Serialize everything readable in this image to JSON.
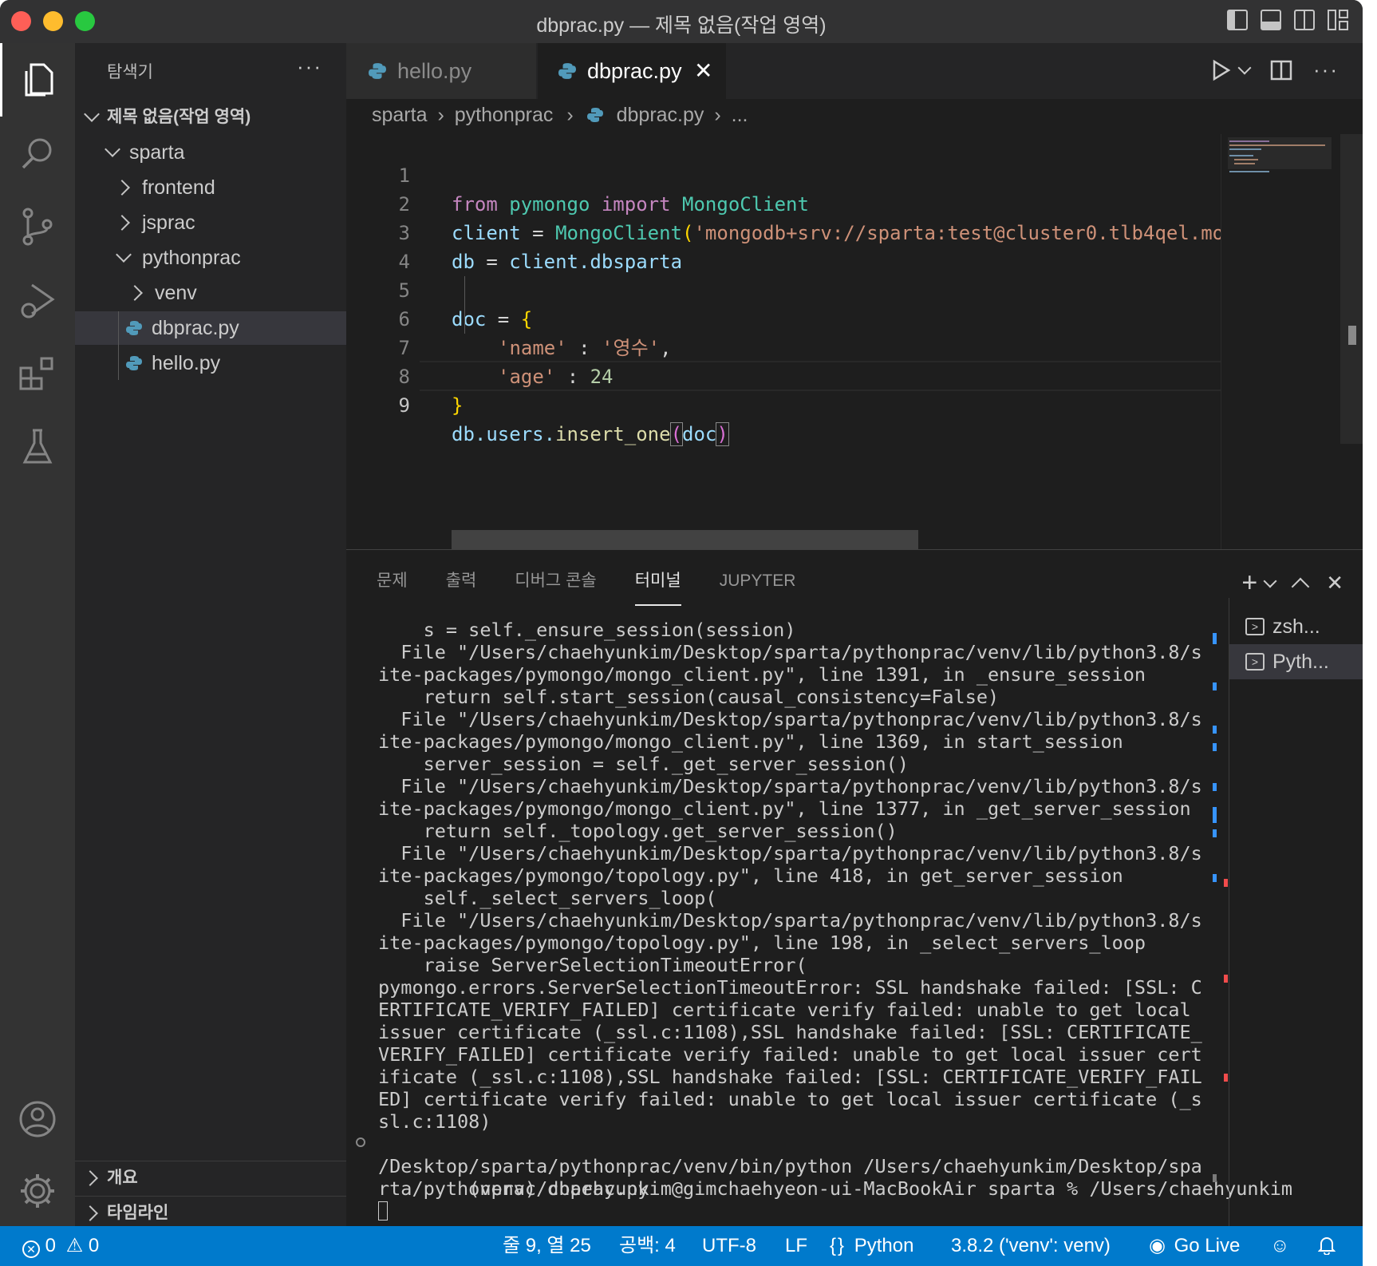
{
  "window": {
    "title": "dbprac.py — 제목 없음(작업 영역)"
  },
  "explorer": {
    "title": "탐색기",
    "workspace": "제목 없음(작업 영역)",
    "items": [
      {
        "label": "sparta"
      },
      {
        "label": "frontend"
      },
      {
        "label": "jsprac"
      },
      {
        "label": "pythonprac"
      },
      {
        "label": "venv"
      },
      {
        "label": "dbprac.py"
      },
      {
        "label": "hello.py"
      }
    ],
    "sections": [
      {
        "label": "개요"
      },
      {
        "label": "타임라인"
      }
    ]
  },
  "tabs": [
    {
      "label": "hello.py"
    },
    {
      "label": "dbprac.py"
    }
  ],
  "breadcrumb": [
    "sparta",
    "pythonprac",
    "dbprac.py",
    "..."
  ],
  "code": {
    "line_numbers": [
      "1",
      "2",
      "3",
      "4",
      "5",
      "6",
      "7",
      "8",
      "9"
    ],
    "tokens": {
      "l1_from": "from",
      "l1_mod": "pymongo",
      "l1_import": "import",
      "l1_cls": "MongoClient",
      "l2_var": "client",
      "l2_eq": " = ",
      "l2_cls": "MongoClient",
      "l2_paren": "(",
      "l2_str": "'mongodb+srv://sparta:test@cluster0.tlb4qel.mo",
      "l3_var": "db",
      "l3_eq": " = ",
      "l3_obj": "client",
      "l3_attr": ".dbsparta",
      "l5_var": "doc",
      "l5_eq": " = ",
      "l5_brace": "{",
      "l6_key": "'name'",
      "l6_sep": " : ",
      "l6_val": "'영수'",
      "l6_comma": ",",
      "l7_key": "'age'",
      "l7_sep": " : ",
      "l7_val": "24",
      "l8_brace": "}",
      "l9_obj": "db",
      "l9_attr": ".users.",
      "l9_fn": "insert_one",
      "l9_open": "(",
      "l9_arg": "doc",
      "l9_close": ")"
    }
  },
  "panel": {
    "tabs": [
      {
        "label": "문제"
      },
      {
        "label": "출력"
      },
      {
        "label": "디버그 콘솔"
      },
      {
        "label": "터미널"
      },
      {
        "label": "JUPYTER"
      }
    ],
    "terminal_lines": [
      "    s = self._ensure_session(session)",
      "  File \"/Users/chaehyunkim/Desktop/sparta/pythonprac/venv/lib/python3.8/s",
      "ite-packages/pymongo/mongo_client.py\", line 1391, in _ensure_session",
      "    return self.start_session(causal_consistency=False)",
      "  File \"/Users/chaehyunkim/Desktop/sparta/pythonprac/venv/lib/python3.8/s",
      "ite-packages/pymongo/mongo_client.py\", line 1369, in start_session",
      "    server_session = self._get_server_session()",
      "  File \"/Users/chaehyunkim/Desktop/sparta/pythonprac/venv/lib/python3.8/s",
      "ite-packages/pymongo/mongo_client.py\", line 1377, in _get_server_session",
      "    return self._topology.get_server_session()",
      "  File \"/Users/chaehyunkim/Desktop/sparta/pythonprac/venv/lib/python3.8/s",
      "ite-packages/pymongo/topology.py\", line 418, in get_server_session",
      "    self._select_servers_loop(",
      "  File \"/Users/chaehyunkim/Desktop/sparta/pythonprac/venv/lib/python3.8/s",
      "ite-packages/pymongo/topology.py\", line 198, in _select_servers_loop",
      "    raise ServerSelectionTimeoutError(",
      "pymongo.errors.ServerSelectionTimeoutError: SSL handshake failed: [SSL: C",
      "ERTIFICATE_VERIFY_FAILED] certificate verify failed: unable to get local",
      "issuer certificate (_ssl.c:1108),SSL handshake failed: [SSL: CERTIFICATE_",
      "VERIFY_FAILED] certificate verify failed: unable to get local issuer cert",
      "ificate (_ssl.c:1108),SSL handshake failed: [SSL: CERTIFICATE_VERIFY_FAIL",
      "ED] certificate verify failed: unable to get local issuer certificate (_s",
      "sl.c:1108)",
      "(venv) chaehyunkim@gimchaehyeon-ui-MacBookAir sparta % /Users/chaehyunkim",
      "/Desktop/sparta/pythonprac/venv/bin/python /Users/chaehyunkim/Desktop/spa",
      "rta/pythonprac/dbprac.py"
    ],
    "terminals": [
      {
        "label": "zsh..."
      },
      {
        "label": "Pyth..."
      }
    ]
  },
  "status": {
    "errors": "0",
    "warnings": "0",
    "position": "줄 9, 열 25",
    "spaces": "공백: 4",
    "encoding": "UTF-8",
    "eol": "LF",
    "language": "Python",
    "interpreter": "3.8.2 ('venv': venv)",
    "golive": "Go Live"
  },
  "colors": {
    "accent": "#007acc",
    "statusbar": "#007acc"
  }
}
